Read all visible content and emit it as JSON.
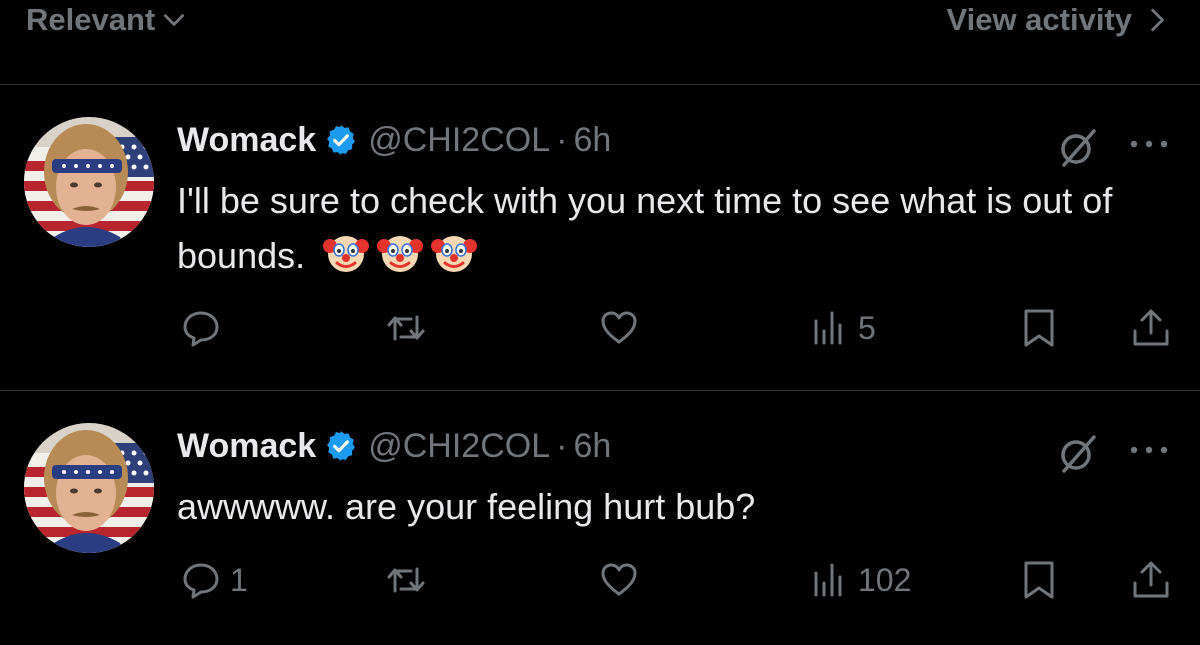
{
  "topbar": {
    "sort_label": "Relevant",
    "view_activity_label": "View activity"
  },
  "replies": [
    {
      "author": {
        "name": "Womack",
        "handle": "@CHI2COL",
        "separator": "·",
        "time": "6h",
        "verified": true
      },
      "text": "I'll be sure to check with you next time to see what is out of bounds.",
      "emoji": [
        "clown-face",
        "clown-face",
        "clown-face"
      ],
      "stats": {
        "replies": "",
        "reposts": "",
        "likes": "",
        "views": "5"
      }
    },
    {
      "author": {
        "name": "Womack",
        "handle": "@CHI2COL",
        "separator": "·",
        "time": "6h",
        "verified": true
      },
      "text": "awwwww. are your feeling hurt bub?",
      "stats": {
        "replies": "1",
        "reposts": "",
        "likes": "",
        "views": "102"
      }
    }
  ],
  "colors": {
    "background": "#000000",
    "text": "#e7e9ea",
    "muted": "#71767b",
    "divider": "#2f3336",
    "verified": "#1d9bf0"
  },
  "icons": {
    "sort": "chevron-down-icon",
    "view_activity": "chevron-right-icon",
    "reply": "speech-bubble-icon",
    "repost": "repost-icon",
    "like": "heart-icon",
    "views": "bar-chart-icon",
    "bookmark": "bookmark-icon",
    "share": "share-icon",
    "grok": "grok-slash-circle-icon",
    "more": "more-dots-icon"
  }
}
